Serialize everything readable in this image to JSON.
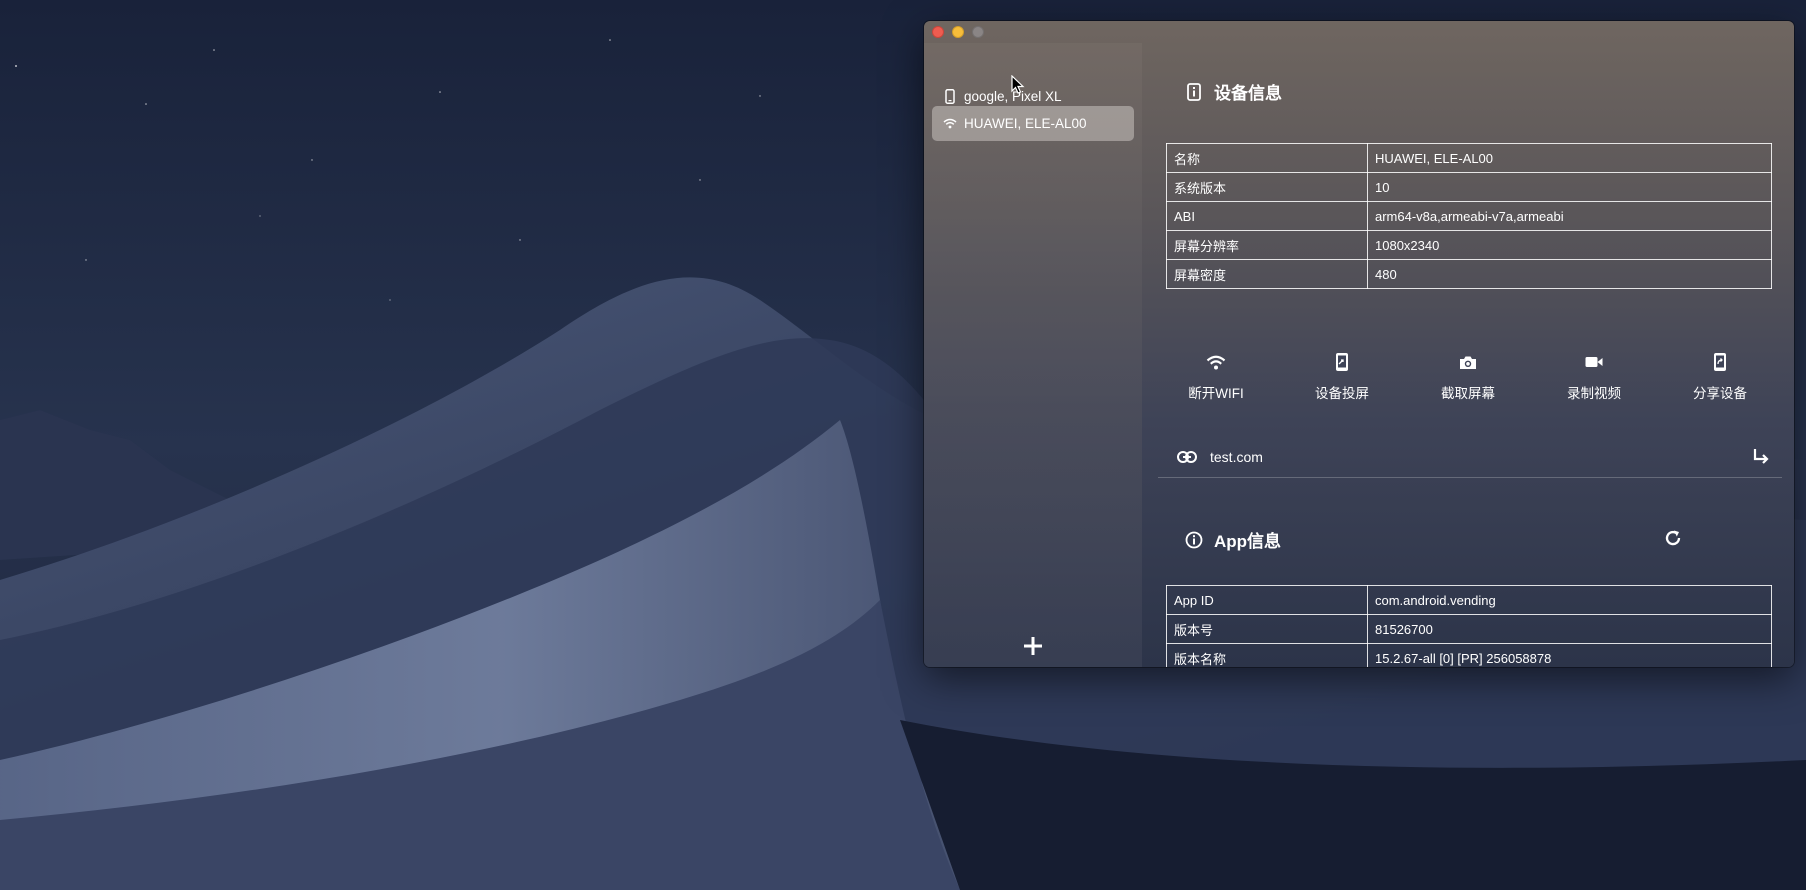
{
  "sidebar": {
    "devices": [
      {
        "name": "google, Pixel XL",
        "connection": "usb",
        "icon": "phone-icon"
      },
      {
        "name": "HUAWEI, ELE-AL00",
        "connection": "wifi",
        "icon": "wifi-icon",
        "selected": true
      }
    ],
    "add_icon": "plus-icon"
  },
  "device_info": {
    "title": "设备信息",
    "icon": "device-info-icon",
    "rows": [
      {
        "label": "名称",
        "value": "HUAWEI, ELE-AL00"
      },
      {
        "label": "系统版本",
        "value": "10"
      },
      {
        "label": "ABI",
        "value": "arm64-v8a,armeabi-v7a,armeabi"
      },
      {
        "label": "屏幕分辨率",
        "value": "1080x2340"
      },
      {
        "label": "屏幕密度",
        "value": "480"
      }
    ]
  },
  "actions": [
    {
      "label": "断开WIFI",
      "icon": "wifi-icon"
    },
    {
      "label": "设备投屏",
      "icon": "screen-mirror-icon"
    },
    {
      "label": "截取屏幕",
      "icon": "camera-icon"
    },
    {
      "label": "录制视频",
      "icon": "video-camera-icon"
    },
    {
      "label": "分享设备",
      "icon": "share-device-icon"
    }
  ],
  "link": {
    "text": "test.com",
    "icon": "link-icon",
    "go_icon": "arrow-turn-right-icon"
  },
  "app_info": {
    "title": "App信息",
    "icon": "info-circle-icon",
    "refresh_icon": "refresh-icon",
    "rows": [
      {
        "label": "App ID",
        "value": "com.android.vending"
      },
      {
        "label": "版本号",
        "value": "81526700"
      },
      {
        "label": "版本名称",
        "value": "15.2.67-all [0] [PR] 256058878"
      },
      {
        "label": "",
        "value": ""
      }
    ]
  },
  "colors": {
    "selected_item": "#c8c3c0",
    "traffic_red": "#ee5c50",
    "traffic_yellow": "#f6bd3b",
    "traffic_gray": "#8a8585"
  }
}
